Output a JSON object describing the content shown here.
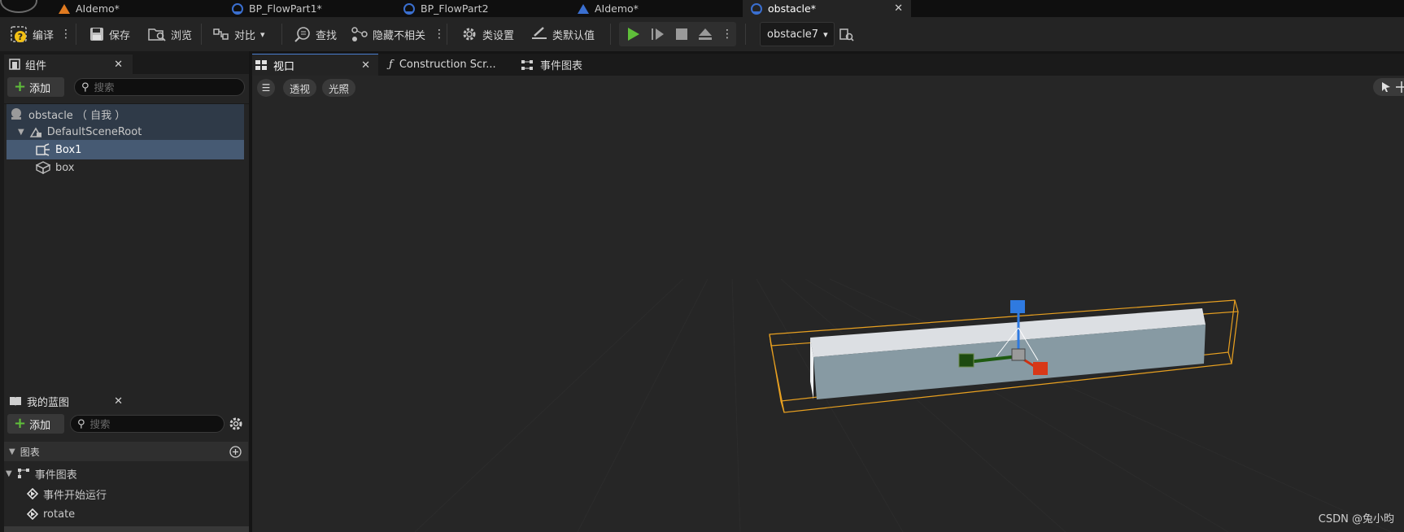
{
  "doc_tabs": [
    {
      "label": "AIdemo*",
      "icon": "level-icon"
    },
    {
      "label": "BP_FlowPart1*",
      "icon": "blueprint-icon"
    },
    {
      "label": "BP_FlowPart2",
      "icon": "blueprint-icon"
    },
    {
      "label": "AIdemo*",
      "icon": "level-icon"
    },
    {
      "label": "obstacle*",
      "icon": "blueprint-icon",
      "active": true
    }
  ],
  "toolbar": {
    "compile": "编译",
    "save": "保存",
    "browse": "浏览",
    "diff": "对比",
    "find": "查找",
    "hide_unrelated": "隐藏不相关",
    "class_settings": "类设置",
    "class_defaults": "类默认值",
    "debug_object": "obstacle7"
  },
  "components_panel": {
    "title": "组件",
    "add": "添加",
    "search_placeholder": "搜索",
    "items": [
      {
        "label": "obstacle （ 自我 ）",
        "icon": "actor-icon"
      },
      {
        "label": "DefaultSceneRoot",
        "icon": "scene-root-icon"
      },
      {
        "label": "Box1",
        "icon": "box-collision-icon",
        "selected": true
      },
      {
        "label": "box",
        "icon": "static-mesh-icon"
      }
    ]
  },
  "my_blueprint_panel": {
    "title": "我的蓝图",
    "add": "添加",
    "search_placeholder": "搜索",
    "section": "图表",
    "graph": "事件图表",
    "events": [
      "事件开始运行",
      "rotate"
    ]
  },
  "viewport_tabs": [
    {
      "label": "视口",
      "active": true
    },
    {
      "label": "Construction Scr..."
    },
    {
      "label": "事件图表"
    }
  ],
  "viewport": {
    "perspective": "透视",
    "lighting": "光照"
  },
  "watermark": "CSDN @兔小昀",
  "colors": {
    "accent": "#4a7ed0",
    "selection": "#465a73",
    "play_green": "#5fbf3a",
    "bounds_orange": "#e8a020"
  }
}
